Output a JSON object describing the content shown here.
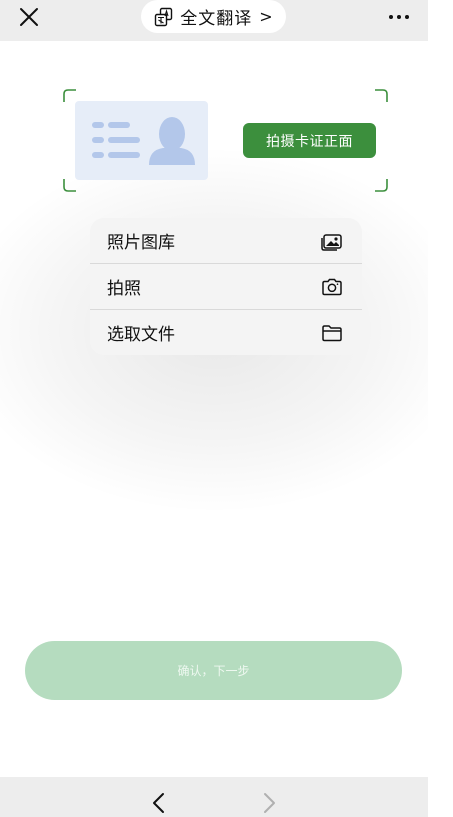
{
  "header": {
    "title": "全文翻译",
    "title_chevron": ">",
    "close_icon": "close-icon",
    "more_icon": "more-icon",
    "translate_icon": "translate-icon"
  },
  "capture": {
    "button_label": "拍摄卡证正面",
    "illustration_icon": "id-card-icon"
  },
  "menu": {
    "items": [
      {
        "label": "照片图库",
        "icon": "photo-library-icon"
      },
      {
        "label": "拍照",
        "icon": "camera-icon"
      },
      {
        "label": "选取文件",
        "icon": "folder-icon"
      }
    ]
  },
  "footer": {
    "confirm_label": "确认，下一步"
  },
  "bottom_nav": {
    "back_icon": "chevron-left-icon",
    "forward_icon": "chevron-right-icon"
  },
  "colors": {
    "accent": "#3c8f3d",
    "confirm_disabled": "#b5dcbf",
    "bar_bg": "#ededed",
    "menu_bg": "#f4f4f4",
    "card_bg": "#e6edf8",
    "card_glyph": "#b3c7ea"
  }
}
